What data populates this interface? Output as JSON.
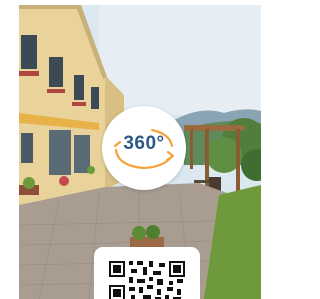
{
  "viewer": {
    "badge_label": "360°",
    "badge_icon": "rotate-360-icon",
    "qr_icon": "qr-code-icon",
    "colors": {
      "badge_text": "#2b5a86",
      "badge_arrows": "#f2a33a",
      "sky": "#dbe8f0",
      "building": "#ead39a",
      "pavement": "#a99d92",
      "grass": "#6f9a3c"
    }
  }
}
